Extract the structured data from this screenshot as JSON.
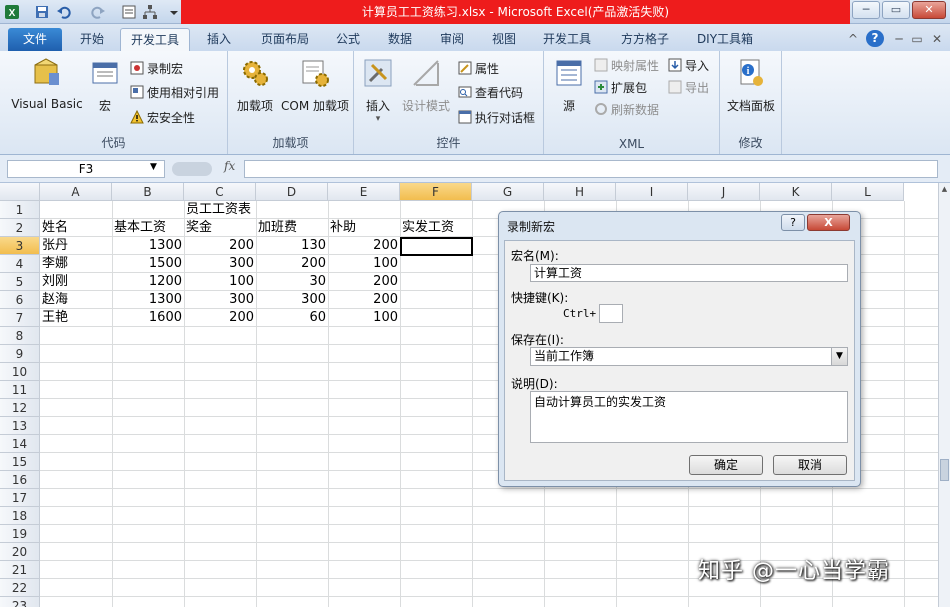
{
  "window": {
    "title": "计算员工工资练习.xlsx - Microsoft Excel(产品激活失败)",
    "controls": {
      "minimize": "─",
      "restore": "▭",
      "close": "✕"
    }
  },
  "quick_access": {
    "icons": [
      "excel-app-icon",
      "save-icon",
      "undo-icon",
      "redo-icon",
      "form-icon",
      "tree-icon",
      "dropdown-icon"
    ]
  },
  "tabs": [
    "文件",
    "开始",
    "开发工具",
    "插入",
    "页面布局",
    "公式",
    "数据",
    "审阅",
    "视图",
    "开发工具",
    "方方格子",
    "DIY工具箱"
  ],
  "tab_right_icons": {
    "minimize_ribbon": "^",
    "help": "?",
    "window_min": "─",
    "window_restore": "▭",
    "window_close": "✕"
  },
  "ribbon": {
    "code": {
      "label": "代码",
      "visual_basic": "Visual Basic",
      "macros": "宏",
      "record_macro": "录制宏",
      "relative_ref": "使用相对引用",
      "macro_security": "宏安全性"
    },
    "addins": {
      "label": "加载项",
      "addins": "加载项",
      "com_addins": "COM 加载项"
    },
    "controls": {
      "label": "控件",
      "insert": "插入",
      "design_mode": "设计模式",
      "properties": "属性",
      "view_code": "查看代码",
      "run_dialog": "执行对话框"
    },
    "xml": {
      "label": "XML",
      "source": "源",
      "map_properties": "映射属性",
      "expansion_packs": "扩展包",
      "refresh_data": "刷新数据",
      "import": "导入",
      "export": "导出"
    },
    "modify": {
      "label": "修改",
      "document_panel": "文档面板"
    }
  },
  "formula_bar": {
    "name_box": "F3",
    "fx": "fx",
    "formula": ""
  },
  "sheet": {
    "columns": [
      "A",
      "B",
      "C",
      "D",
      "E",
      "F",
      "G",
      "H",
      "I",
      "J",
      "K",
      "L"
    ],
    "rows": [
      "1",
      "2",
      "3",
      "4",
      "5",
      "6",
      "7",
      "8",
      "9",
      "10",
      "11",
      "12",
      "13",
      "14",
      "15",
      "16",
      "17",
      "18",
      "19",
      "20",
      "21",
      "22",
      "23"
    ],
    "selected_cell": "F3",
    "title": "员工工资表",
    "headers": [
      "姓名",
      "基本工资",
      "奖金",
      "加班费",
      "补助",
      "实发工资"
    ],
    "records": [
      {
        "name": "张丹",
        "base": "1300",
        "bonus": "200",
        "overtime": "130",
        "subsidy": "200"
      },
      {
        "name": "李娜",
        "base": "1500",
        "bonus": "300",
        "overtime": "200",
        "subsidy": "100"
      },
      {
        "name": "刘刚",
        "base": "1200",
        "bonus": "100",
        "overtime": "30",
        "subsidy": "200"
      },
      {
        "name": "赵海",
        "base": "1300",
        "bonus": "300",
        "overtime": "300",
        "subsidy": "200"
      },
      {
        "name": "王艳",
        "base": "1600",
        "bonus": "200",
        "overtime": "60",
        "subsidy": "100"
      }
    ]
  },
  "dialog": {
    "title": "录制新宏",
    "help": "?",
    "close": "X",
    "macro_name_label": "宏名(M):",
    "macro_name_value": "计算工资",
    "shortcut_label": "快捷键(K):",
    "shortcut_prefix": "Ctrl+",
    "shortcut_value": "",
    "store_in_label": "保存在(I):",
    "store_in_value": "当前工作簿",
    "description_label": "说明(D):",
    "description_value": "自动计算员工的实发工资",
    "ok": "确定",
    "cancel": "取消"
  },
  "watermark": "知乎 @一心当学霸"
}
